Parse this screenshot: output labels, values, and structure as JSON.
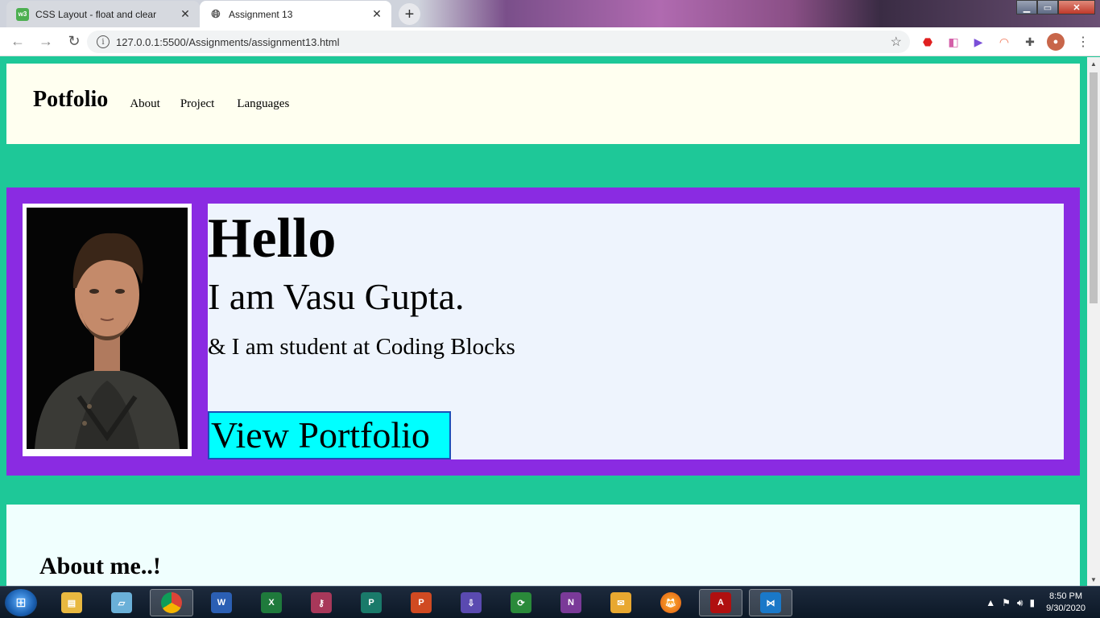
{
  "browser": {
    "tabs": [
      {
        "title": "CSS Layout - float and clear",
        "favicon": "w3schools-icon",
        "active": false
      },
      {
        "title": "Assignment 13",
        "favicon": "globe-icon",
        "active": true
      }
    ],
    "new_tab": "+",
    "address": "127.0.0.1:5500/Assignments/assignment13.html",
    "window_controls": {
      "minimize": "▁",
      "maximize": "▭",
      "close": "✕"
    }
  },
  "page": {
    "nav": {
      "brand": "Potfolio",
      "links": [
        "About",
        "Project",
        "Languages"
      ]
    },
    "hero": {
      "heading": "Hello",
      "name": "I am Vasu Gupta.",
      "subtitle": "& I am student at Coding Blocks",
      "button": "View Portfolio"
    },
    "about": {
      "heading": "About me..!"
    },
    "colors": {
      "page_bg": "#1ec898",
      "nav_bg": "#fffff0",
      "hero_bg": "#8a2be2",
      "content_bg": "#eef4fd",
      "button_bg": "#00ffff",
      "about_bg": "#f0fffe"
    }
  },
  "taskbar": {
    "apps": [
      "explorer",
      "notes",
      "chrome",
      "word",
      "excel",
      "powerpoint",
      "publisher",
      "outlook-like",
      "project",
      "onenote",
      "outlook",
      "firefox",
      "acrobat",
      "vscode"
    ],
    "time": "8:50 PM",
    "date": "9/30/2020"
  }
}
